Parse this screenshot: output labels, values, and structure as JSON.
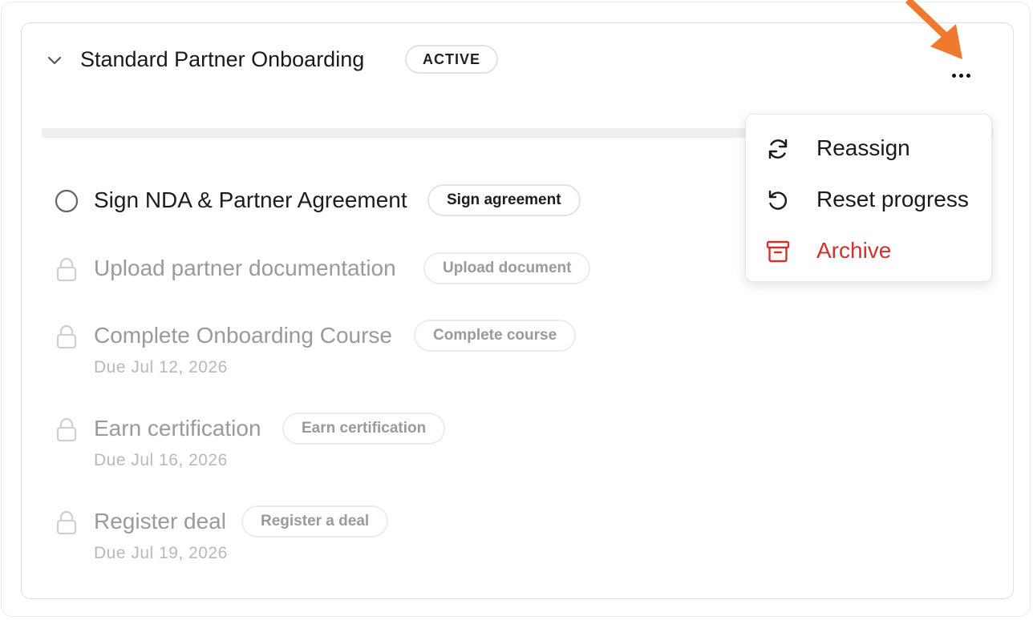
{
  "workflow": {
    "title": "Standard Partner Onboarding",
    "status": "ACTIVE",
    "more_icon": "more-horizontal-icon",
    "collapse_icon": "chevron-down-icon"
  },
  "tasks": [
    {
      "label": "Sign NDA & Partner Agreement",
      "action": "Sign agreement",
      "due": "",
      "state": "active",
      "icon": "circle-icon"
    },
    {
      "label": "Upload partner documentation",
      "action": "Upload document",
      "due": "",
      "state": "locked",
      "icon": "lock-icon"
    },
    {
      "label": "Complete Onboarding Course",
      "action": "Complete course",
      "due": "Due Jul 12, 2026",
      "state": "locked",
      "icon": "lock-icon"
    },
    {
      "label": "Earn certification",
      "action": "Earn certification",
      "due": "Due Jul 16, 2026",
      "state": "locked",
      "icon": "lock-icon"
    },
    {
      "label": "Register deal",
      "action": "Register a deal",
      "due": "Due Jul 19, 2026",
      "state": "locked",
      "icon": "lock-icon"
    }
  ],
  "menu": {
    "items": [
      {
        "label": "Reassign",
        "icon": "refresh-icon",
        "variant": "default"
      },
      {
        "label": "Reset progress",
        "icon": "reset-icon",
        "variant": "default"
      },
      {
        "label": "Archive",
        "icon": "archive-icon",
        "variant": "danger"
      }
    ]
  },
  "colors": {
    "danger": "#d1322e",
    "annotation_arrow": "#ef7a2e",
    "locked_text": "#9a9a9a"
  }
}
